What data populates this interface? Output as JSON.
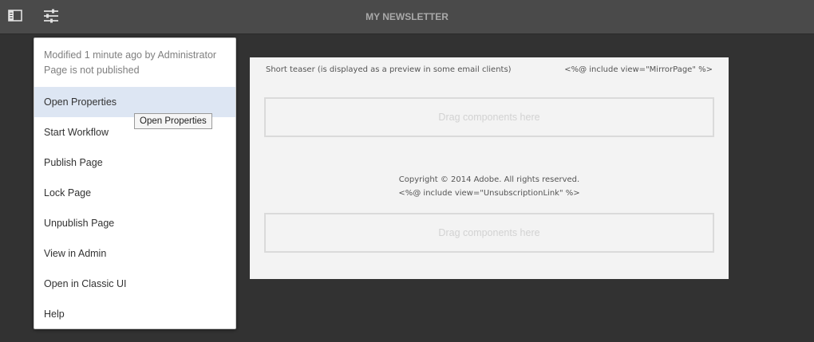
{
  "header": {
    "title": "MY NEWSLETTER",
    "side_panel_icon": "side-panel-icon",
    "page_info_icon": "sliders-icon"
  },
  "page_info": {
    "modified": "Modified 1 minute ago by Administrator",
    "status": "Page is not published",
    "menu": [
      "Open Properties",
      "Start Workflow",
      "Publish Page",
      "Lock Page",
      "Unpublish Page",
      "View in Admin",
      "Open in Classic UI",
      "Help"
    ],
    "tooltip": "Open Properties"
  },
  "canvas": {
    "teaser": "Short teaser (is displayed as a preview in some email clients)",
    "mirror_include": "<%@ include view=\"MirrorPage\" %>",
    "dropzone_label": "Drag components here",
    "copyright": "Copyright © 2014 Adobe. All rights reserved.",
    "unsubscribe_include": "<%@ include view=\"UnsubscriptionLink\" %>"
  },
  "colors": {
    "background": "#323232",
    "toolbar": "#4a4a4a",
    "menu_highlight": "#dde6f3"
  }
}
